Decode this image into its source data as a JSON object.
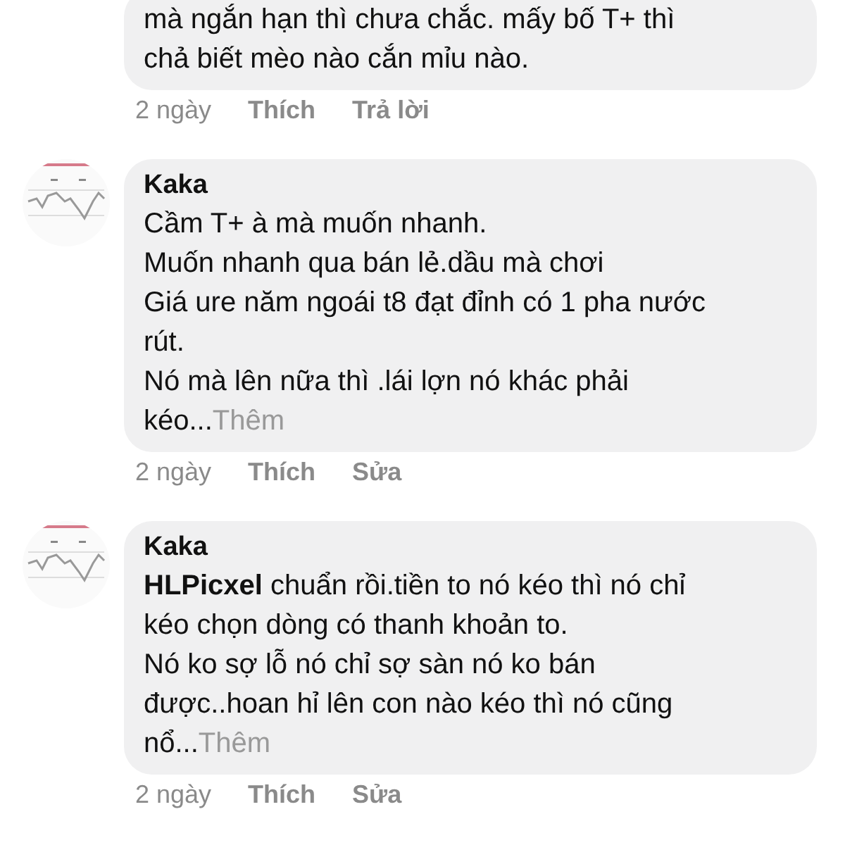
{
  "comments": [
    {
      "text": "mà ngắn hạn thì chưa chắc. mấy bố T+ thì\nchả biết mèo nào cắn mỉu nào.",
      "time": "2 ngày",
      "actions": [
        "Thích",
        "Trả lời"
      ]
    },
    {
      "avatar": {
        "kind": "picture"
      },
      "name": "Kaka",
      "text": "Cầm T+ à mà muốn nhanh.\nMuốn nhanh qua bán lẻ.dầu mà chơi\nGiá ure năm ngoái t8 đạt đỉnh có 1 pha nước\nrút.\nNó mà lên nữa thì .lái lợn nó khác phải\nkéo...",
      "more": "Thêm",
      "time": "2 ngày",
      "actions": [
        "Thích",
        "Sửa"
      ]
    },
    {
      "avatar": {
        "kind": "picture"
      },
      "name": "Kaka",
      "text": "**HLPicxel**  chuẩn rồi.tiền to nó kéo thì nó chỉ\nkéo chọn dòng có thanh khoản to.\nNó ko sợ lỗ nó chỉ sợ sàn nó ko bán\nđược..hoan hỉ lên con nào kéo thì nó cũng\nnổ...",
      "more": "Thêm",
      "time": "2 ngày",
      "actions": [
        "Thích",
        "Sửa"
      ]
    }
  ]
}
